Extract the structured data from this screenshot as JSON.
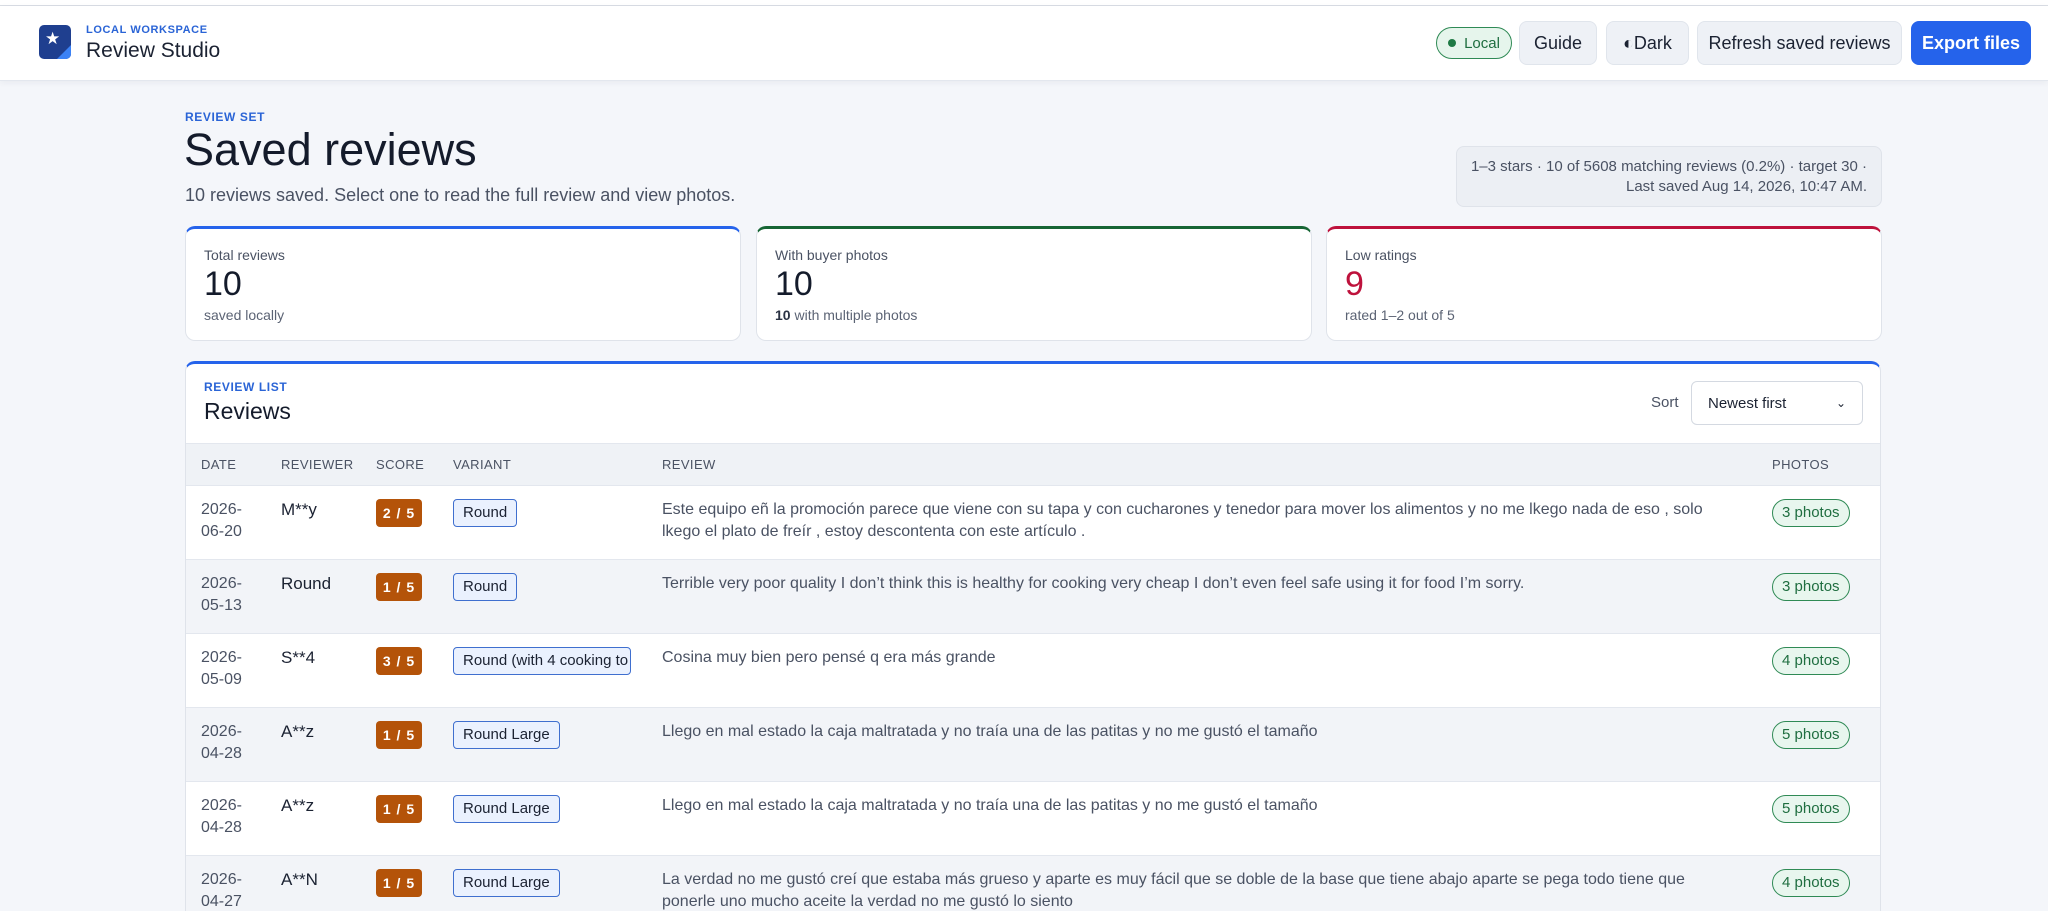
{
  "header": {
    "eyebrow": "LOCAL WORKSPACE",
    "title": "Review Studio",
    "local_label": "Local",
    "guide_label": "Guide",
    "dark_label": "◐Dark",
    "refresh_label": "Refresh saved reviews",
    "export_label": "Export files"
  },
  "page": {
    "eyebrow": "REVIEW SET",
    "title": "Saved reviews",
    "subtitle": "10 reviews saved. Select one to read the full review and view photos.",
    "meta_line1": "1–3 stars · 10 of 5608 matching reviews (0.2%) · target 30 ·",
    "meta_line2": "Last saved Aug 14, 2026, 10:47 AM."
  },
  "stats": [
    {
      "label": "Total reviews",
      "value": "10",
      "sub": "saved locally",
      "accent": "#2563eb"
    },
    {
      "label": "With buyer photos",
      "value": "10",
      "sub_bold": "10",
      "sub": " with multiple photos",
      "accent": "#166534"
    },
    {
      "label": "Low ratings",
      "value": "9",
      "sub": "rated 1–2 out of 5",
      "accent": "#be123c"
    }
  ],
  "list": {
    "eyebrow": "REVIEW LIST",
    "title": "Reviews",
    "sort_label": "Sort",
    "sort_value": "Newest first",
    "columns": [
      "DATE",
      "REVIEWER",
      "SCORE",
      "VARIANT",
      "REVIEW",
      "PHOTOS"
    ],
    "rows": [
      {
        "date1": "2026-",
        "date2": "06-20",
        "reviewer": "M**y",
        "score": "2 / 5",
        "variant": "Round",
        "review": "Este equipo eñ la promoción parece que viene con su tapa y con cucharones y tenedor para mover los alimentos y no me lkego nada de eso , solo lkego el plato de freír , estoy descontenta con este artículo .",
        "photos": "3 photos"
      },
      {
        "date1": "2026-",
        "date2": "05-13",
        "reviewer": "Round",
        "score": "1 / 5",
        "variant": "Round",
        "review": "Terrible very poor quality I don’t think this is healthy for cooking very cheap I don’t even feel safe using it for food I’m sorry.",
        "photos": "3 photos"
      },
      {
        "date1": "2026-",
        "date2": "05-09",
        "reviewer": "S**4",
        "score": "3 / 5",
        "variant": "Round (with 4 cooking to",
        "review": "Cosina muy bien pero pensé q era más grande",
        "photos": "4 photos"
      },
      {
        "date1": "2026-",
        "date2": "04-28",
        "reviewer": "A**z",
        "score": "1 / 5",
        "variant": "Round Large",
        "review": "Llego en mal estado la caja maltratada y no traía una de las patitas y no me gustó el tamaño",
        "photos": "5 photos"
      },
      {
        "date1": "2026-",
        "date2": "04-28",
        "reviewer": "A**z",
        "score": "1 / 5",
        "variant": "Round Large",
        "review": "Llego en mal estado la caja maltratada y no traía una de las patitas y no me gustó el tamaño",
        "photos": "5 photos"
      },
      {
        "date1": "2026-",
        "date2": "04-27",
        "reviewer": "A**N",
        "score": "1 / 5",
        "variant": "Round Large",
        "review": "La verdad no me gustó creí que estaba más grueso y aparte es muy fácil que se doble de la base que tiene abajo aparte se pega todo tiene que ponerle uno mucho aceite la verdad no me gustó lo siento",
        "photos": "4 photos"
      }
    ]
  }
}
